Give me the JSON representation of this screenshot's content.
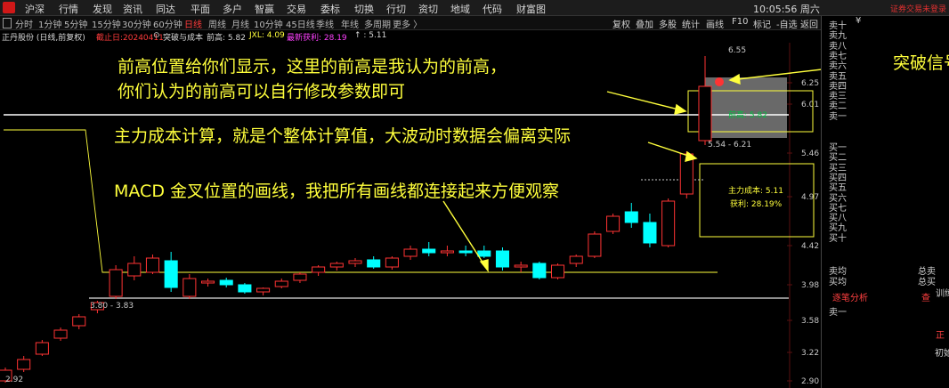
{
  "menu": {
    "items": [
      "沪深",
      "行情",
      "发现",
      "资讯",
      "同达",
      "平面",
      "多户",
      "智赢",
      "交易",
      "委标",
      "切换",
      "行切",
      "资切",
      "地域",
      "代码",
      "财富图"
    ],
    "clock": "10:05:56 周六",
    "login": "证券交易未登录"
  },
  "period_bar": {
    "periods": [
      "分时",
      "1分钟",
      "5分钟",
      "15分钟",
      "30分钟",
      "60分钟",
      "日线",
      "周线",
      "月线",
      "10分钟",
      "45日线",
      "季线",
      "年线",
      "多周期",
      "更多 〉"
    ],
    "active": "日线",
    "tools": [
      "复权",
      "叠加",
      "多股",
      "统计",
      "画线",
      "F10",
      "标记",
      "-自选",
      "返回"
    ]
  },
  "info_bar": {
    "stock": "正丹股份 (日线,前复权)",
    "date": "截止日:20240411",
    "indicator": "突破与成本",
    "prev_high": "前高: 5.82",
    "jxl": "JXL: 4.09",
    "profit": "最新获利: 28.19",
    "last": "↑ : 5.11"
  },
  "chart_data": {
    "type": "candlestick",
    "ylim": [
      2.9,
      6.6
    ],
    "y_ticks": [
      "6.25",
      "6.01",
      "5.46",
      "4.97",
      "4.42",
      "3.98",
      "3.58",
      "3.22",
      "2.90"
    ],
    "candles": [
      {
        "o": 2.9,
        "h": 3.05,
        "l": 2.88,
        "c": 3.02
      },
      {
        "o": 3.03,
        "h": 3.18,
        "l": 3.0,
        "c": 3.14
      },
      {
        "o": 3.2,
        "h": 3.36,
        "l": 3.18,
        "c": 3.33
      },
      {
        "o": 3.38,
        "h": 3.5,
        "l": 3.35,
        "c": 3.47
      },
      {
        "o": 3.52,
        "h": 3.65,
        "l": 3.48,
        "c": 3.62
      },
      {
        "o": 3.7,
        "h": 3.8,
        "l": 3.66,
        "c": 3.78
      },
      {
        "o": 3.85,
        "h": 4.2,
        "l": 3.82,
        "c": 4.15
      },
      {
        "o": 4.08,
        "h": 4.3,
        "l": 4.03,
        "c": 4.22
      },
      {
        "o": 4.12,
        "h": 4.32,
        "l": 4.1,
        "c": 4.28
      },
      {
        "o": 4.25,
        "h": 4.35,
        "l": 3.9,
        "c": 3.95
      },
      {
        "o": 3.85,
        "h": 4.1,
        "l": 3.82,
        "c": 4.05
      },
      {
        "o": 4.0,
        "h": 4.05,
        "l": 3.96,
        "c": 4.02
      },
      {
        "o": 4.03,
        "h": 4.06,
        "l": 3.95,
        "c": 3.98
      },
      {
        "o": 3.98,
        "h": 4.0,
        "l": 3.88,
        "c": 3.9
      },
      {
        "o": 3.9,
        "h": 3.95,
        "l": 3.86,
        "c": 3.94
      },
      {
        "o": 3.96,
        "h": 4.05,
        "l": 3.94,
        "c": 4.02
      },
      {
        "o": 4.03,
        "h": 4.12,
        "l": 4.0,
        "c": 4.1
      },
      {
        "o": 4.12,
        "h": 4.2,
        "l": 4.08,
        "c": 4.18
      },
      {
        "o": 4.18,
        "h": 4.24,
        "l": 4.14,
        "c": 4.22
      },
      {
        "o": 4.22,
        "h": 4.28,
        "l": 4.18,
        "c": 4.25
      },
      {
        "o": 4.26,
        "h": 4.3,
        "l": 4.16,
        "c": 4.18
      },
      {
        "o": 4.18,
        "h": 4.3,
        "l": 4.15,
        "c": 4.28
      },
      {
        "o": 4.3,
        "h": 4.42,
        "l": 4.26,
        "c": 4.38
      },
      {
        "o": 4.38,
        "h": 4.46,
        "l": 4.3,
        "c": 4.34
      },
      {
        "o": 4.34,
        "h": 4.42,
        "l": 4.3,
        "c": 4.36
      },
      {
        "o": 4.36,
        "h": 4.42,
        "l": 4.3,
        "c": 4.34
      },
      {
        "o": 4.36,
        "h": 4.42,
        "l": 4.28,
        "c": 4.3
      },
      {
        "o": 4.36,
        "h": 4.4,
        "l": 4.14,
        "c": 4.18
      },
      {
        "o": 4.18,
        "h": 4.24,
        "l": 4.12,
        "c": 4.2
      },
      {
        "o": 4.22,
        "h": 4.24,
        "l": 4.04,
        "c": 4.06
      },
      {
        "o": 4.06,
        "h": 4.22,
        "l": 4.04,
        "c": 4.2
      },
      {
        "o": 4.22,
        "h": 4.32,
        "l": 4.18,
        "c": 4.3
      },
      {
        "o": 4.3,
        "h": 4.58,
        "l": 4.28,
        "c": 4.55
      },
      {
        "o": 4.58,
        "h": 4.78,
        "l": 4.55,
        "c": 4.75
      },
      {
        "o": 4.8,
        "h": 4.9,
        "l": 4.62,
        "c": 4.68
      },
      {
        "o": 4.68,
        "h": 4.78,
        "l": 4.4,
        "c": 4.45
      },
      {
        "o": 4.42,
        "h": 4.95,
        "l": 4.4,
        "c": 4.92
      },
      {
        "o": 5.0,
        "h": 5.48,
        "l": 4.95,
        "c": 5.45
      },
      {
        "o": 5.6,
        "h": 6.55,
        "l": 5.55,
        "c": 6.21
      }
    ],
    "prev_high_line": 5.82,
    "cost_line": 4.09,
    "low_line": 3.8
  },
  "chart_labels": {
    "range_low": "3.80 - 3.83",
    "range_high": "5.54 - 6.21",
    "peak": "6.55",
    "bottom": "2.92",
    "prev_high_tag": "前高: 5.82",
    "cost_tag": "主力成本: 5.11",
    "profit_tag": "获利: 28.19%"
  },
  "annotations": {
    "a1": "前高位置给你们显示，这里的前高是我认为的前高，",
    "a2": "你们认为的前高可以自行修改参数即可",
    "a3": "主力成本计算，就是个整体计算值，大波动时数据会偏离实际",
    "a4": "MACD 金叉位置的画线，我把所有画线都连接起来方便观察",
    "signal": "突破信号"
  },
  "order_book": {
    "sell": [
      "卖十",
      "卖九",
      "卖八",
      "卖七",
      "卖六",
      "卖五",
      "卖四",
      "卖三",
      "卖二",
      "卖一"
    ],
    "buy": [
      "买一",
      "买二",
      "买三",
      "买四",
      "买五",
      "买六",
      "买七",
      "买八",
      "买九",
      "买十"
    ],
    "sell_avg": "卖均",
    "buy_avg": "买均",
    "total_sell": "总卖",
    "total_buy": "总买",
    "tab_ticks": "逐笔分析",
    "tab_search": "查",
    "row_sell1": "卖一",
    "train": "训练",
    "yen": "¥",
    "side1": "正",
    "side2": "初始"
  },
  "colors": {
    "up": "#ff3333",
    "down": "#00ffff",
    "anno": "#ffff3c",
    "active": "#ff3b3b"
  }
}
